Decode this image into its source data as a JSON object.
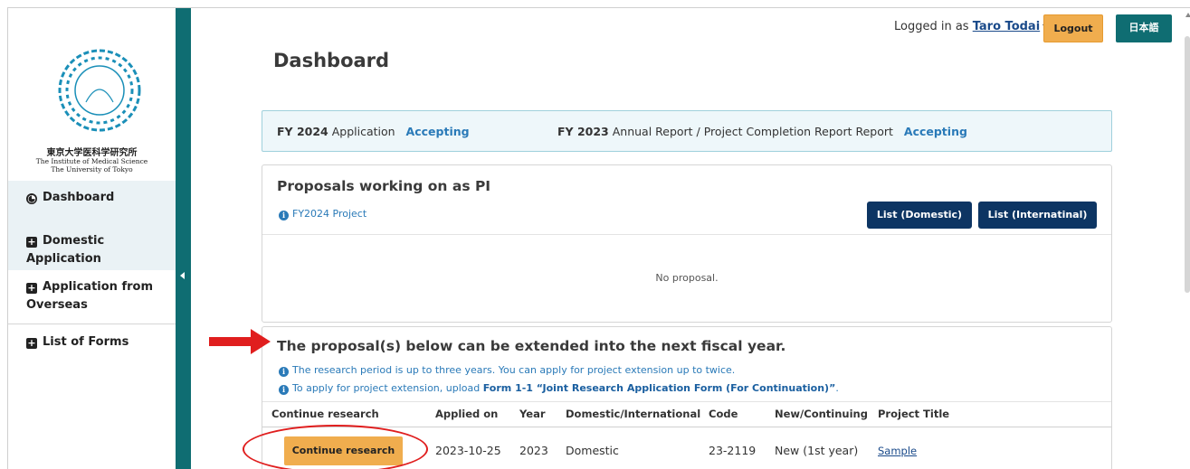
{
  "sidebar": {
    "logo_text_jp": "東京大学医科学研究所",
    "logo_text_en1": "The Institute of Medical Science",
    "logo_text_en2": "The University of Tokyo",
    "items": [
      {
        "label_line1": "Dashboard",
        "label_line2": "",
        "icon": "dashboard-icon"
      },
      {
        "label_line1": "Domestic",
        "label_line2": "Application",
        "icon": "plus-square-icon"
      },
      {
        "label_line1": "Application from",
        "label_line2": "Overseas",
        "icon": "plus-square-icon"
      },
      {
        "label_line1": "List of Forms",
        "label_line2": "",
        "icon": "plus-square-icon"
      }
    ]
  },
  "header": {
    "logged_in_prefix": "Logged in as",
    "user_name": "Taro Todai",
    "logout_label": "Logout",
    "language_label": "日本語"
  },
  "page_title": "Dashboard",
  "status": {
    "item1_year": "FY 2024",
    "item1_label": "Application",
    "item1_state": "Accepting",
    "item2_year": "FY 2023",
    "item2_label": "Annual Report / Project Completion Report Report",
    "item2_state": "Accepting"
  },
  "pi_panel": {
    "title": "Proposals working on as PI",
    "info": "FY2024 Project",
    "btn_domestic": "List (Domestic)",
    "btn_international": "List (Internatinal)",
    "empty_text": "No proposal."
  },
  "extension_panel": {
    "title": "The proposal(s) below can be extended into the next fiscal year.",
    "info1": "The research period is up to three years. You can apply for project extension up to twice.",
    "info2_prefix": "To apply for project extension, upload",
    "info2_form": "Form 1-1 “Joint Research Application Form (For Continuation)”",
    "info2_suffix": ".",
    "columns": [
      "Continue research",
      "Applied on",
      "Year",
      "Domestic/International",
      "Code",
      "New/Continuing",
      "Project Title"
    ],
    "rows": [
      {
        "action": "Continue research",
        "applied_on": "2023-10-25",
        "year": "2023",
        "type": "Domestic",
        "code": "23-2119",
        "status": "New (1st year)",
        "title": "Sample"
      }
    ]
  },
  "colors": {
    "accent_teal": "#0f6d72",
    "button_orange": "#f0ad4e",
    "button_navy": "#0d3563",
    "link_blue": "#2a7ab8",
    "annotation_red": "#e01e1e"
  }
}
